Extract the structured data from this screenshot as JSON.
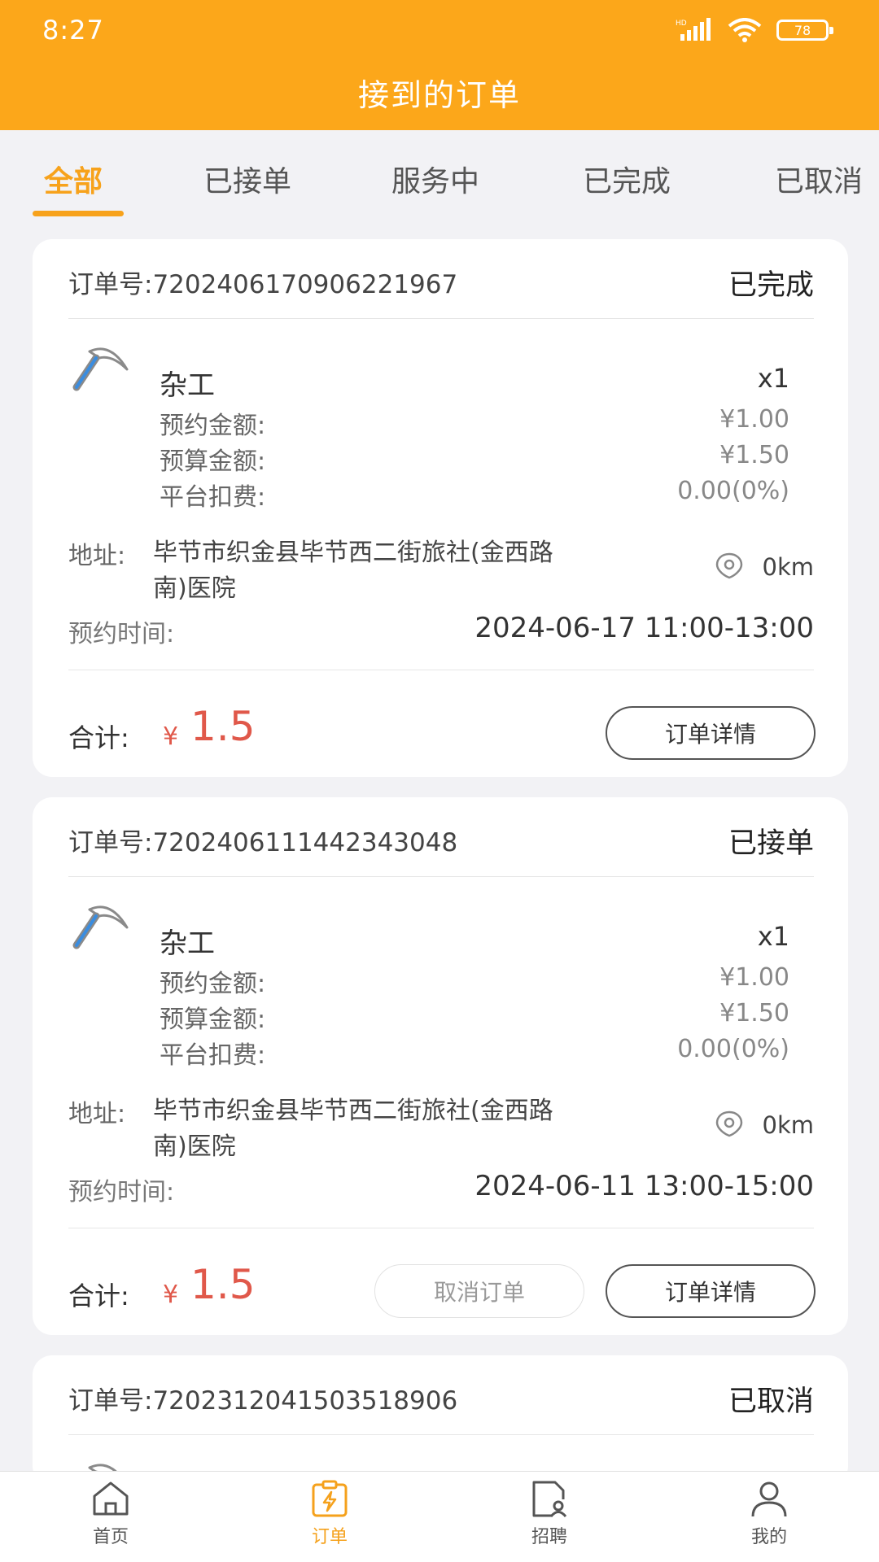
{
  "status_bar": {
    "time": "8:27",
    "hd": "HD",
    "battery": "78"
  },
  "header": {
    "title": "接到的订单"
  },
  "tabs": [
    {
      "label": "全部",
      "active": true
    },
    {
      "label": "已接单",
      "active": false
    },
    {
      "label": "服务中",
      "active": false
    },
    {
      "label": "已完成",
      "active": false
    },
    {
      "label": "已取消",
      "active": false
    }
  ],
  "orders": [
    {
      "order_no": "订单号:7202406170906221967",
      "status": "已完成",
      "service_name": "杂工",
      "quantity": "x1",
      "rows": [
        {
          "label": "预约金额:",
          "value": "¥1.00"
        },
        {
          "label": "预算金额:",
          "value": "¥1.50"
        },
        {
          "label": "平台扣费:",
          "value": "0.00(0%)"
        }
      ],
      "address_label": "地址:",
      "address": "毕节市织金县毕节西二街旅社(金西路南)医院",
      "distance": "0km",
      "appt_label": "预约时间:",
      "appt_time": "2024-06-17 11:00-13:00",
      "total_label": "合计:",
      "currency": "¥",
      "total": "1.5",
      "detail_label": "订单详情"
    },
    {
      "order_no": "订单号:7202406111442343048",
      "status": "已接单",
      "service_name": "杂工",
      "quantity": "x1",
      "rows": [
        {
          "label": "预约金额:",
          "value": "¥1.00"
        },
        {
          "label": "预算金额:",
          "value": "¥1.50"
        },
        {
          "label": "平台扣费:",
          "value": "0.00(0%)"
        }
      ],
      "address_label": "地址:",
      "address": "毕节市织金县毕节西二街旅社(金西路南)医院",
      "distance": "0km",
      "appt_label": "预约时间:",
      "appt_time": "2024-06-11 13:00-15:00",
      "total_label": "合计:",
      "currency": "¥",
      "total": "1.5",
      "cancel_label": "取消订单",
      "detail_label": "订单详情"
    },
    {
      "order_no": "订单号:7202312041503518906",
      "status": "已取消"
    }
  ],
  "bottom_nav": [
    {
      "label": "首页",
      "icon": "home-icon",
      "active": false
    },
    {
      "label": "订单",
      "icon": "order-icon",
      "active": true
    },
    {
      "label": "招聘",
      "icon": "recruit-icon",
      "active": false
    },
    {
      "label": "我的",
      "icon": "profile-icon",
      "active": false
    }
  ],
  "colors": {
    "accent": "#fca71a",
    "price": "#e0584a",
    "active_tab": "#f7a21b"
  }
}
